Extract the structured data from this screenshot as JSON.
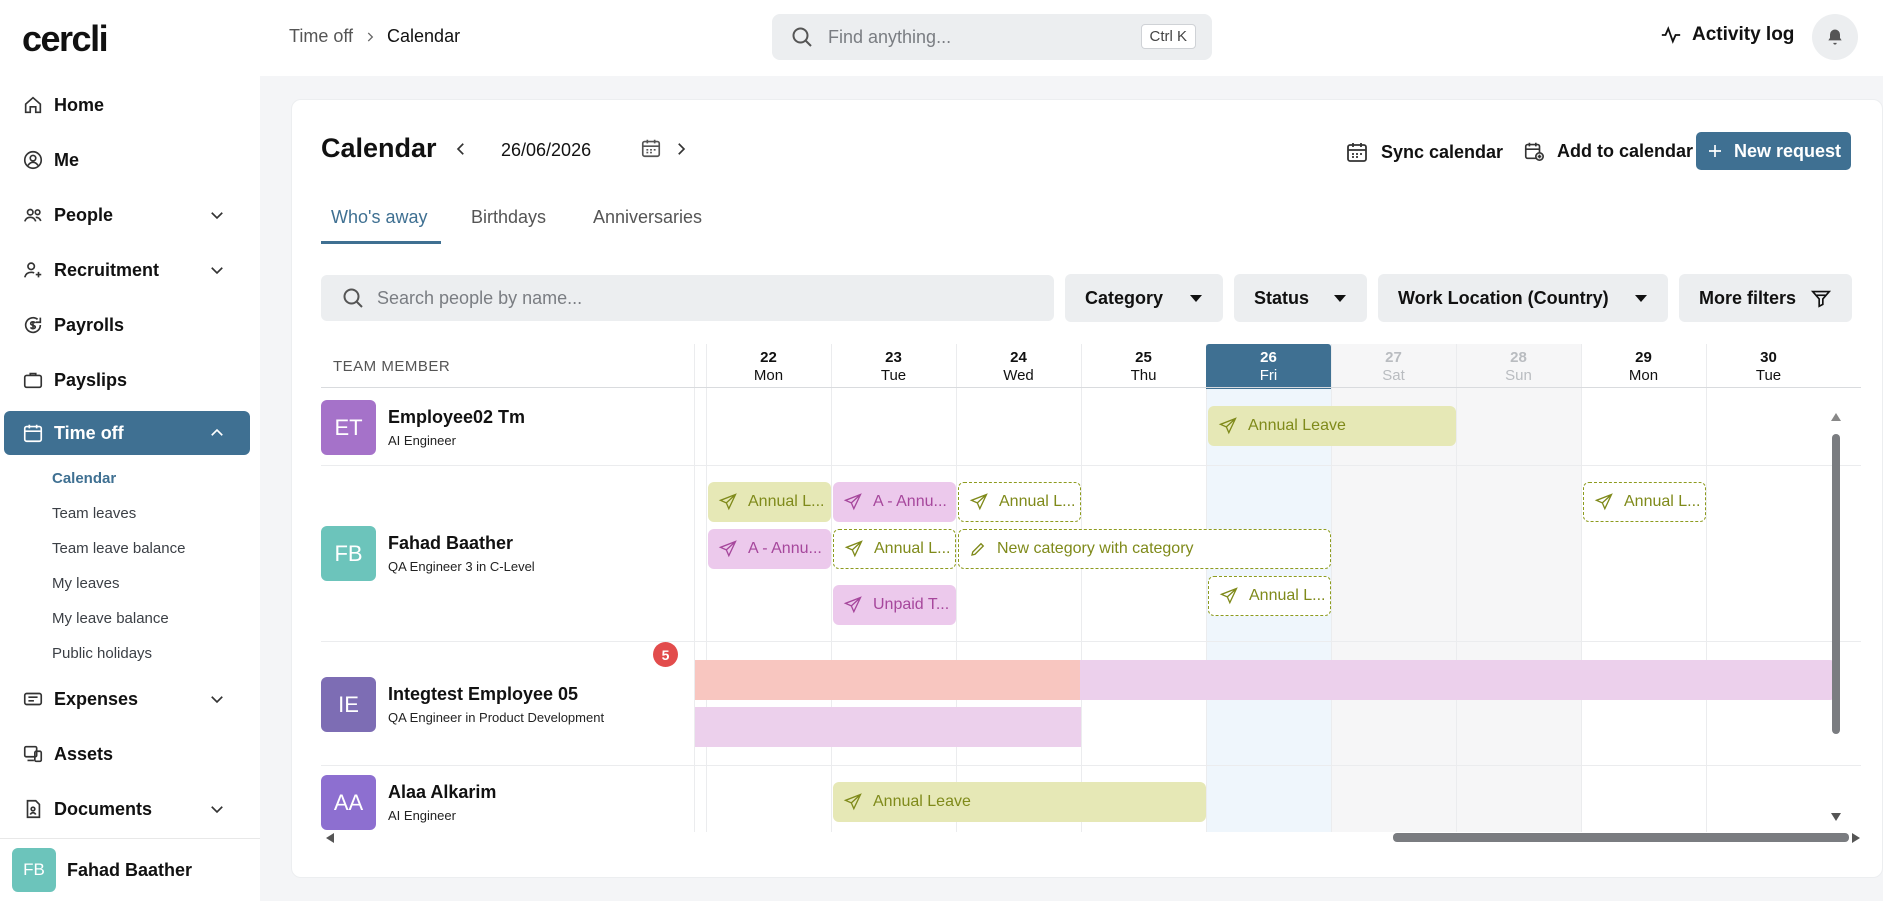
{
  "brand": "cercli",
  "sidebar": {
    "items": [
      {
        "label": "Home"
      },
      {
        "label": "Me"
      },
      {
        "label": "People"
      },
      {
        "label": "Recruitment"
      },
      {
        "label": "Payrolls"
      },
      {
        "label": "Payslips"
      },
      {
        "label": "Time off"
      },
      {
        "label": "Expenses"
      },
      {
        "label": "Assets"
      },
      {
        "label": "Documents"
      }
    ],
    "sub_items": [
      {
        "label": "Calendar"
      },
      {
        "label": "Team leaves"
      },
      {
        "label": "Team leave balance"
      },
      {
        "label": "My leaves"
      },
      {
        "label": "My leave balance"
      },
      {
        "label": "Public holidays"
      }
    ],
    "user": {
      "initials": "FB",
      "name": "Fahad Baather"
    }
  },
  "header": {
    "breadcrumb": {
      "parent": "Time off",
      "current": "Calendar"
    },
    "search": {
      "placeholder": "Find anything...",
      "shortcut": "Ctrl K"
    },
    "activity_log": "Activity log"
  },
  "calendar": {
    "title": "Calendar",
    "date": "26/06/2026",
    "actions": {
      "sync": "Sync calendar",
      "add": "Add to calendar",
      "new_request": "New request"
    },
    "tabs": [
      {
        "label": "Who's away"
      },
      {
        "label": "Birthdays"
      },
      {
        "label": "Anniversaries"
      }
    ],
    "people_search_placeholder": "Search people by name...",
    "filters": {
      "category": "Category",
      "status": "Status",
      "work_location": "Work Location (Country)",
      "more": "More filters"
    },
    "team_member_header": "TEAM MEMBER",
    "days": [
      {
        "num": "22",
        "name": "Mon",
        "kind": "normal"
      },
      {
        "num": "23",
        "name": "Tue",
        "kind": "normal"
      },
      {
        "num": "24",
        "name": "Wed",
        "kind": "normal"
      },
      {
        "num": "25",
        "name": "Thu",
        "kind": "normal"
      },
      {
        "num": "26",
        "name": "Fri",
        "kind": "today"
      },
      {
        "num": "27",
        "name": "Sat",
        "kind": "weekend"
      },
      {
        "num": "28",
        "name": "Sun",
        "kind": "weekend"
      },
      {
        "num": "29",
        "name": "Mon",
        "kind": "normal"
      },
      {
        "num": "30",
        "name": "Tue",
        "kind": "normal"
      }
    ],
    "members": [
      {
        "initials": "ET",
        "name": "Employee02 Tm",
        "role": "AI Engineer",
        "color": "#a572c9"
      },
      {
        "initials": "FB",
        "name": "Fahad Baather",
        "role": "QA Engineer 3 in C-Level",
        "color": "#6cc4bb",
        "badge": "5"
      },
      {
        "initials": "IE",
        "name": "Integtest Employee 05",
        "role": "QA Engineer in Product Development",
        "color": "#7d6db4"
      },
      {
        "initials": "AA",
        "name": "Alaa Alkarim",
        "role": "AI Engineer",
        "color": "#8d6fd0"
      }
    ],
    "events": {
      "e1": "Annual Leave",
      "e2": "Annual L...",
      "e3": "A - Annu...",
      "e4": "Annual L...",
      "e5": "Annual L...",
      "e6": "A - Annu...",
      "e7": "Annual L...",
      "e8": "New category with category",
      "e9": "Unpaid T...",
      "e10": "Annual L...",
      "e11": "Annual Leave"
    }
  }
}
